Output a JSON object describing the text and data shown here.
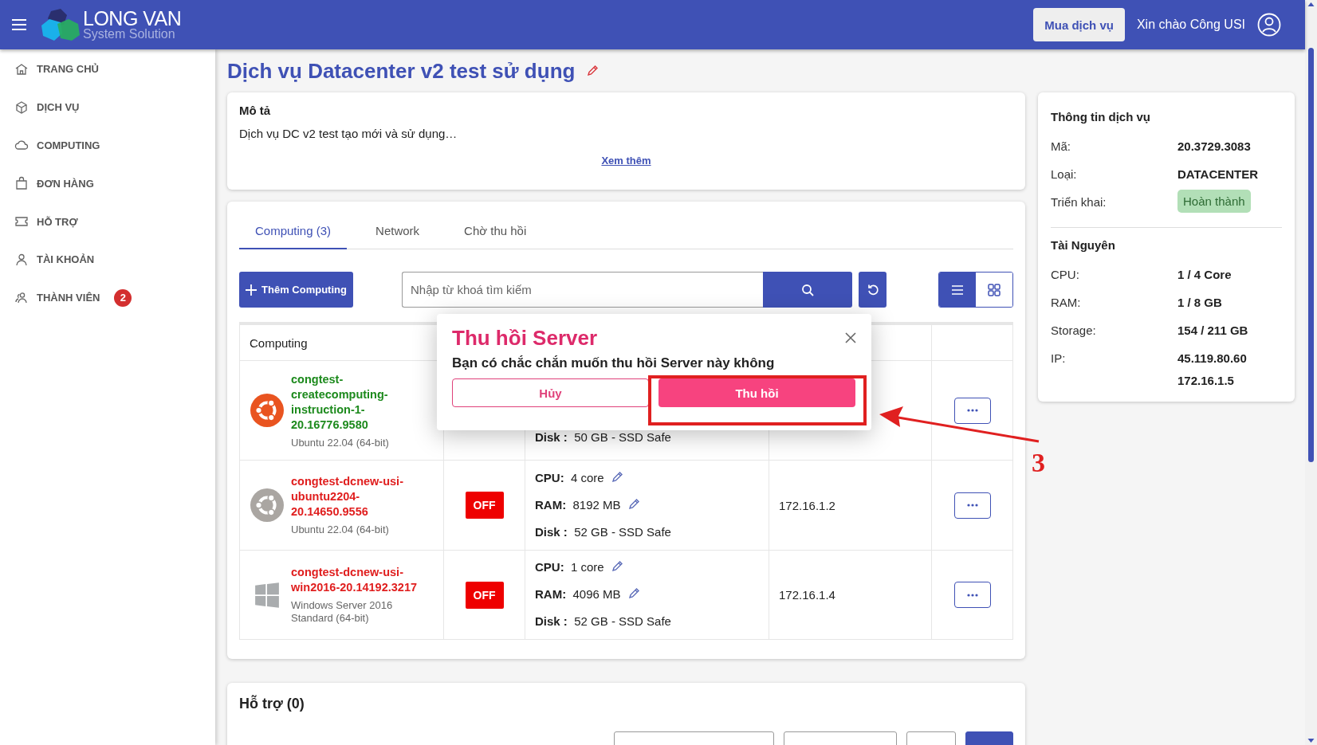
{
  "header": {
    "brand": "LONG VAN",
    "tagline": "System Solution",
    "buy_button": "Mua dịch vụ",
    "greeting": "Xin chào Công USI"
  },
  "sidebar": {
    "items": [
      {
        "label": "TRANG CHỦ",
        "selected": false
      },
      {
        "label": "DỊCH VỤ",
        "selected": false
      },
      {
        "label": "COMPUTING",
        "selected": false
      },
      {
        "label": "ĐƠN HÀNG",
        "selected": false
      },
      {
        "label": "HỖ TRỢ",
        "selected": false
      },
      {
        "label": "TÀI KHOẢN",
        "selected": false
      },
      {
        "label": "THÀNH VIÊN",
        "selected": false,
        "badge": "2"
      }
    ]
  },
  "page": {
    "title": "Dịch vụ Datacenter v2 test sử dụng"
  },
  "description": {
    "heading": "Mô tả",
    "text": "Dịch vụ DC v2 test tạo mới và sử dụng…",
    "link": "Xem thêm"
  },
  "tabs": [
    {
      "label": "Computing (3)",
      "selected": true
    },
    {
      "label": "Network",
      "selected": false
    },
    {
      "label": "Chờ thu hồi",
      "selected": false
    }
  ],
  "toolbar": {
    "add_button": "Thêm Computing",
    "search": {
      "placeholder": "Nhập từ khoá tìm kiếm"
    },
    "views": [
      {
        "selected": true
      },
      {
        "selected": false
      }
    ]
  },
  "table": {
    "columns": [
      "Computing"
    ],
    "rows": [
      {
        "name": "congtest-createcomputing-instruction-1-20.16776.9580",
        "os": "Ubuntu 22.04 (64-bit)",
        "kind": "ubuntu",
        "running": true,
        "specs": [
          {
            "label": "Disk :",
            "value": "50 GB - SSD Safe",
            "editable": false
          }
        ]
      },
      {
        "name": "congtest-dcnew-usi-ubuntu2204-20.14650.9556",
        "os": "Ubuntu 22.04 (64-bit)",
        "kind": "ubuntu",
        "running": false,
        "status": {
          "label": "OFF",
          "on": false
        },
        "specs": [
          {
            "label": "CPU:",
            "value": "4 core",
            "editable": true
          },
          {
            "label": "RAM:",
            "value": "8192 MB",
            "editable": true
          },
          {
            "label": "Disk :",
            "value": "52 GB - SSD Safe",
            "editable": false
          }
        ],
        "ip": "172.16.1.2"
      },
      {
        "name": "congtest-dcnew-usi-win2016-20.14192.3217",
        "os": "Windows Server 2016 Standard (64-bit)",
        "kind": "windows",
        "running": false,
        "status": {
          "label": "OFF",
          "on": false
        },
        "specs": [
          {
            "label": "CPU:",
            "value": "1 core",
            "editable": true
          },
          {
            "label": "RAM:",
            "value": "4096 MB",
            "editable": true
          },
          {
            "label": "Disk :",
            "value": "52 GB - SSD Safe",
            "editable": false
          }
        ],
        "ip": "172.16.1.4"
      }
    ]
  },
  "support": {
    "heading": "Hỗ trợ (0)"
  },
  "info_panel": {
    "sections": [
      {
        "heading": "Thông tin dịch vụ",
        "rows": [
          {
            "label": "Mã:",
            "values": [
              "20.3729.3083"
            ]
          },
          {
            "label": "Loại:",
            "values": [
              "DATACENTER"
            ]
          },
          {
            "label": "Triển khai:",
            "kind": "badge",
            "values": [
              "Hoàn thành"
            ]
          }
        ]
      },
      {
        "heading": "Tài Nguyên",
        "rows": [
          {
            "label": "CPU:",
            "values": [
              "1 / 4 Core"
            ]
          },
          {
            "label": "RAM:",
            "values": [
              "1 / 8 GB"
            ]
          },
          {
            "label": "Storage:",
            "values": [
              "154 / 211 GB"
            ]
          },
          {
            "label": "IP:",
            "values": [
              "45.119.80.60",
              "172.16.1.5"
            ]
          }
        ]
      }
    ]
  },
  "dialog": {
    "title": "Thu hồi Server",
    "message": "Bạn có chắc chắn muốn thu hồi Server này không",
    "cancel": "Hủy",
    "confirm": "Thu hồi"
  },
  "annotation": {
    "label": "3"
  }
}
